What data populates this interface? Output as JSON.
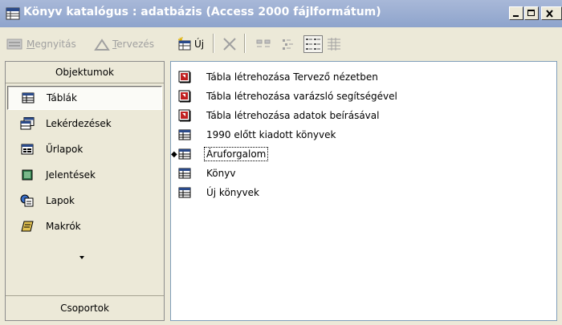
{
  "window": {
    "title": "Könyv katalógus : adatbázis (Access 2000 fájlformátum)",
    "controls": [
      "minimize",
      "maximize",
      "close"
    ]
  },
  "toolbar": {
    "open_label": "Megnyitás",
    "open_accel": "M",
    "design_label": "Tervezés",
    "design_accel": "T",
    "new_label": "Új",
    "icons": [
      "delete-icon",
      "large-icons-view-icon",
      "small-icons-view-icon",
      "list-view-icon",
      "details-view-icon"
    ]
  },
  "objects_panel": {
    "header": "Objektumok",
    "items": [
      {
        "label": "Táblák",
        "icon": "table-icon",
        "selected": true
      },
      {
        "label": "Lekérdezések",
        "icon": "query-icon",
        "selected": false
      },
      {
        "label": "Űrlapok",
        "icon": "form-icon",
        "selected": false
      },
      {
        "label": "Jelentések",
        "icon": "report-icon",
        "selected": false
      },
      {
        "label": "Lapok",
        "icon": "page-icon",
        "selected": false
      },
      {
        "label": "Makrók",
        "icon": "macro-icon",
        "selected": false
      }
    ],
    "groups_label": "Csoportok"
  },
  "list": {
    "items": [
      {
        "label": "Tábla létrehozása Tervező nézetben",
        "icon": "wizard-shortcut-icon"
      },
      {
        "label": "Tábla létrehozása varázsló segítségével",
        "icon": "wizard-shortcut-icon"
      },
      {
        "label": "Tábla létrehozása adatok beírásával",
        "icon": "wizard-shortcut-icon"
      },
      {
        "label": "1990 előtt kiadott könyvek",
        "icon": "table-icon"
      },
      {
        "label": "Áruforgalom",
        "icon": "table-icon",
        "focused": true
      },
      {
        "label": "Könyv",
        "icon": "table-icon"
      },
      {
        "label": "Új könyvek",
        "icon": "table-icon"
      }
    ]
  }
}
